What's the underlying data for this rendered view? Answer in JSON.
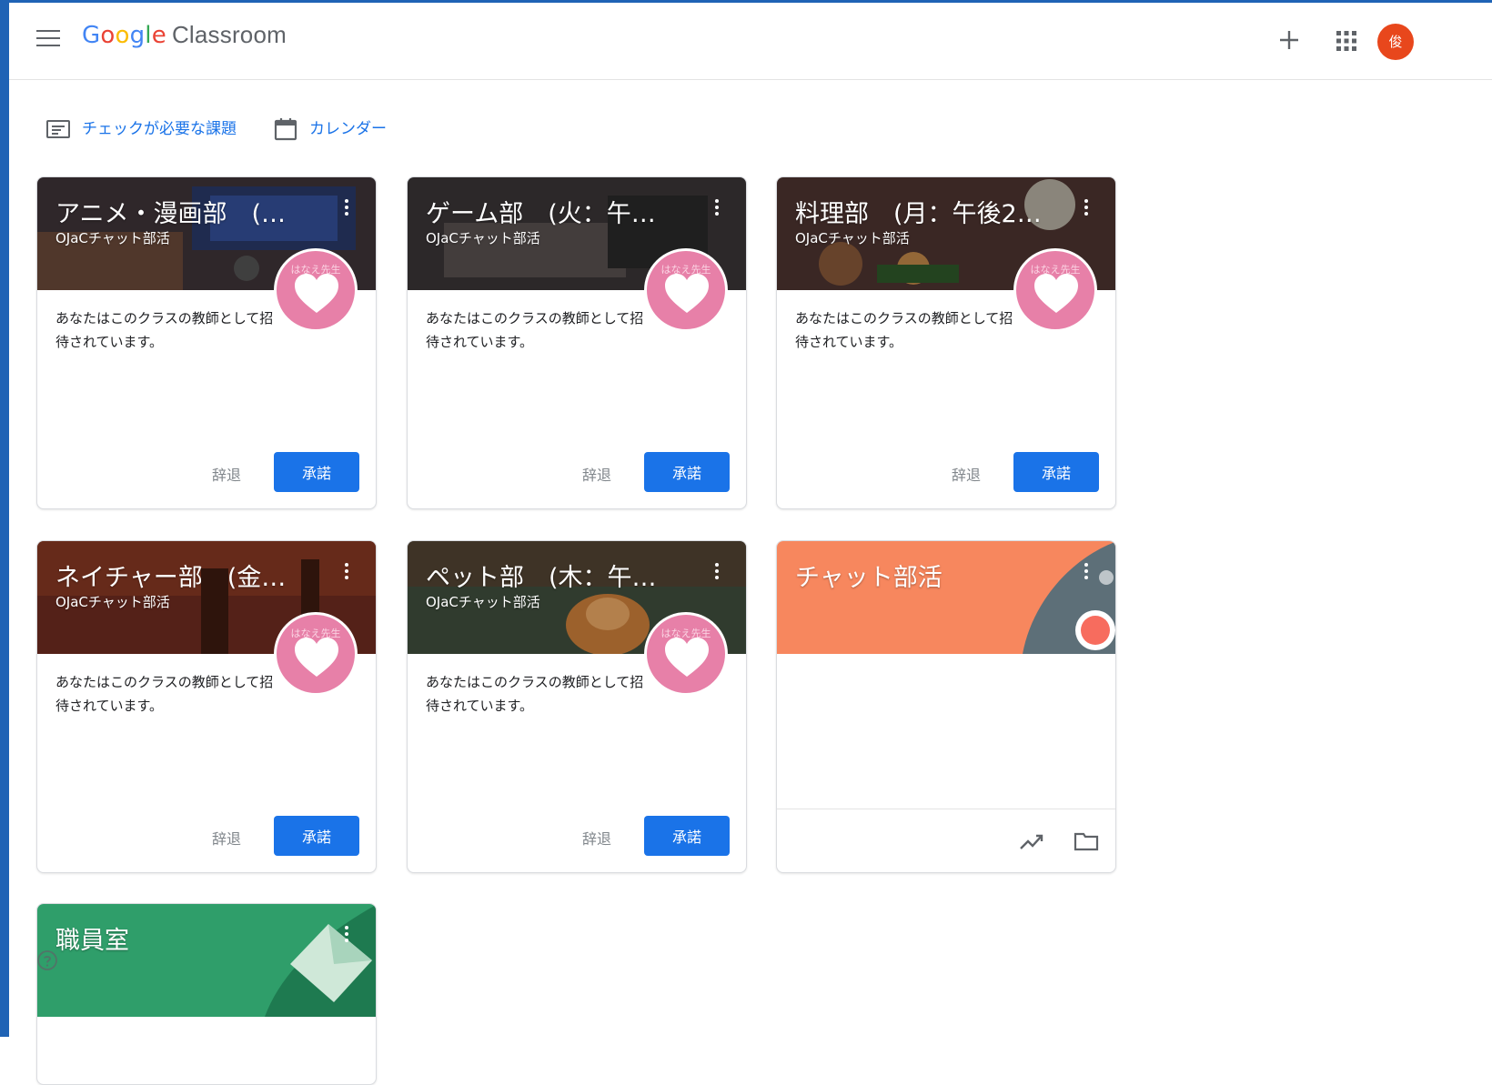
{
  "header": {
    "brand_google": [
      "G",
      "o",
      "o",
      "g",
      "l",
      "e"
    ],
    "brand_product": "Classroom",
    "avatar_initial": "俊"
  },
  "quicklinks": [
    {
      "label": "チェックが必要な課題",
      "icon": "assignment-icon"
    },
    {
      "label": "カレンダー",
      "icon": "calendar-icon"
    }
  ],
  "invite": {
    "description": "あなたはこのクラスの教師として招待されています。",
    "decline_label": "辞退",
    "accept_label": "承諾",
    "teacher_name": "はなえ先生"
  },
  "cards": [
    {
      "title": "アニメ・漫画部　(…",
      "section": "OJaCチャット部活",
      "theme": "#4a3a3e"
    },
    {
      "title": "ゲーム部　(火：午…",
      "section": "OJaCチャット部活",
      "theme": "#3a3536"
    },
    {
      "title": "料理部　(月：午後2…",
      "section": "OJaCチャット部活",
      "theme": "#5a3a32"
    },
    {
      "title": "ネイチャー部　(金…",
      "section": "OJaCチャット部活",
      "theme": "#6a2a1e"
    },
    {
      "title": "ペット部　(木：午…",
      "section": "OJaCチャット部活",
      "theme": "#3d4a3a"
    },
    {
      "title": "チャット部活",
      "theme": "#f7875e"
    },
    {
      "title": "職員室",
      "theme": "#2f9e6a"
    }
  ]
}
